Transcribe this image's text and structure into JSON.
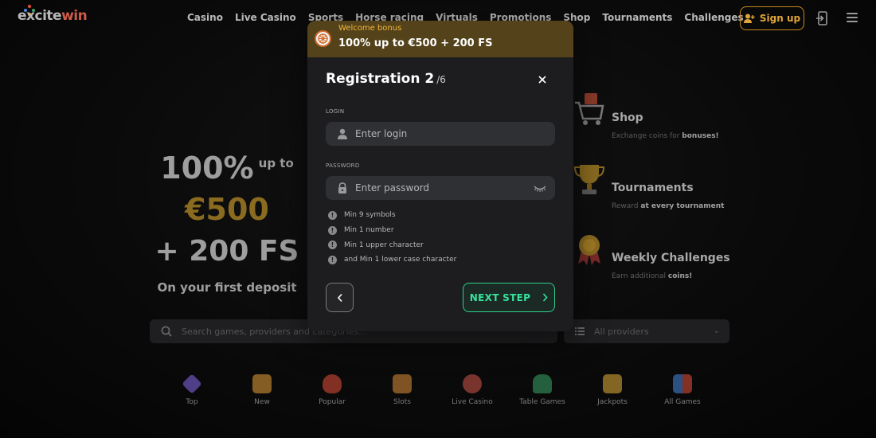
{
  "header": {
    "logo_prefix": "excite",
    "logo_suffix": "win",
    "nav": [
      "Casino",
      "Live Casino",
      "Sports",
      "Horse racing",
      "Virtuals",
      "Promotions",
      "Shop",
      "Tournaments",
      "Challenges"
    ],
    "signup_label": "Sign up"
  },
  "promo": {
    "percent": "100%",
    "upto": "up to",
    "amount": "€500",
    "spins": "+ 200 FS",
    "subtitle": "On your first deposit"
  },
  "features": [
    {
      "title": "Shop",
      "desc_plain": "Exchange coins for ",
      "desc_bold": "bonuses!",
      "icon": "cart-icon"
    },
    {
      "title": "Tournaments",
      "desc_plain": "Reward ",
      "desc_bold": "at every tournament",
      "icon": "trophy-icon"
    },
    {
      "title": "Weekly Challenges",
      "desc_plain": "Earn additional ",
      "desc_bold": "coins!",
      "icon": "medal-icon"
    }
  ],
  "search": {
    "placeholder": "Search games, providers and categories..."
  },
  "providers": {
    "label": "All providers"
  },
  "categories": [
    {
      "label": "Top",
      "icon": "diamond-icon",
      "color": "#8a6cf0"
    },
    {
      "label": "New",
      "icon": "ribbon-icon",
      "color": "#e8a23a"
    },
    {
      "label": "Popular",
      "icon": "fire-icon",
      "color": "#e8503a"
    },
    {
      "label": "Slots",
      "icon": "slot-machine-icon",
      "color": "#e0903a"
    },
    {
      "label": "Live Casino",
      "icon": "dealer-icon",
      "color": "#d65a4a"
    },
    {
      "label": "Table Games",
      "icon": "table-icon",
      "color": "#3aa86a"
    },
    {
      "label": "Jackpots",
      "icon": "crown-icon",
      "color": "#e8b23a"
    },
    {
      "label": "All Games",
      "icon": "grid-icon",
      "color": "#4a8ae8"
    }
  ],
  "modal": {
    "banner_label": "Welcome bonus",
    "banner_title": "100% up to €500 + 200 FS",
    "title": "Registration 2",
    "step": "/6",
    "login_label": "LOGIN",
    "login_placeholder": "Enter login",
    "password_label": "PASSWORD",
    "password_placeholder": "Enter password",
    "rules": [
      "Min 9 symbols",
      "Min 1 number",
      "Min 1 upper character",
      "and Min 1 lower case character"
    ],
    "next_label": "NEXT STEP"
  },
  "colors": {
    "accent_green": "#37e39c",
    "brand_gold": "#f4b63a",
    "banner_bg": "#54431a"
  }
}
